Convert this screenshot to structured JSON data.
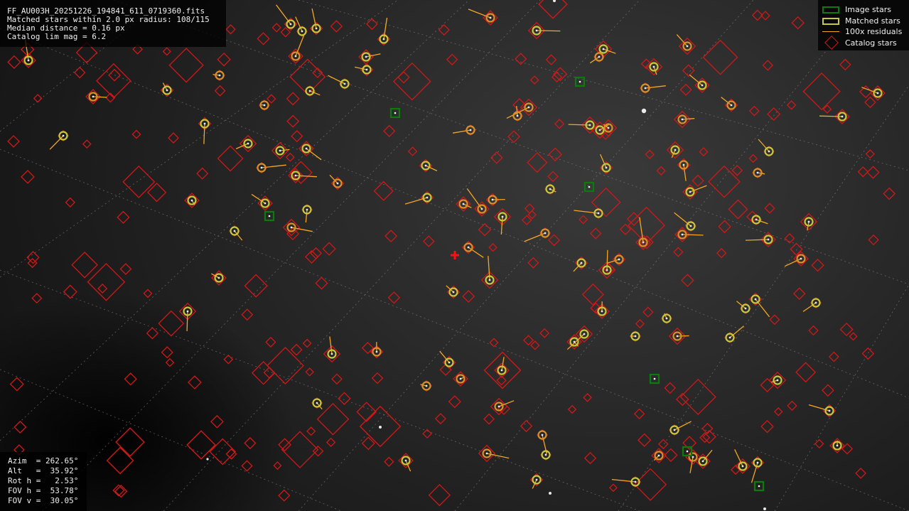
{
  "info": {
    "lines": [
      "FF_AU003H_20251226_194841_611_0719360.fits",
      "Matched stars within 2.0 px radius: 108/115",
      "Median distance = 0.16 px",
      "Catalog lim mag = 6.2"
    ]
  },
  "position": {
    "lines": [
      "Azim  = 262.65°",
      "Alt   =  35.92°",
      "Rot h =   2.53°",
      "FOV h =  53.78°",
      "FOV v =  30.05°"
    ]
  },
  "legend": {
    "items": [
      {
        "label": "Image stars",
        "icon": "green-square-icon"
      },
      {
        "label": "Matched stars",
        "icon": "yellow-circle-icon"
      },
      {
        "label": "100x residuals",
        "icon": "orange-line-icon"
      },
      {
        "label": "Catalog stars",
        "icon": "red-diamond-icon"
      }
    ]
  },
  "colors": {
    "image_star": "#0c7a0c",
    "matched_star": "#c8c83c",
    "matched_star_alt": "#d8902a",
    "residual": "#f5a623",
    "catalog_star": "#d01818",
    "center_marker": "#ff1010",
    "grid": "#8a8a8a"
  }
}
